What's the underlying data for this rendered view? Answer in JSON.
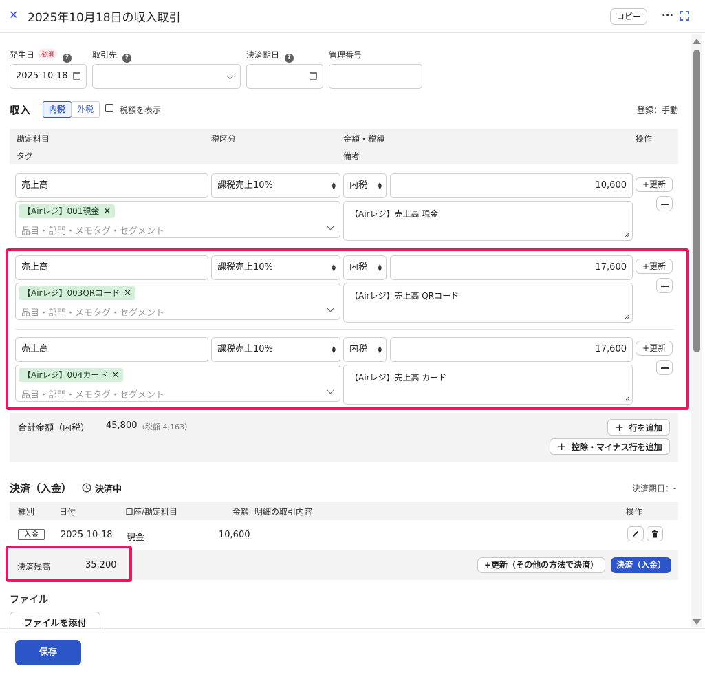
{
  "header": {
    "close_icon": "close-icon",
    "title": "2025年10月18日の収入取引",
    "copy_label": "コピー",
    "more_icon": "more-icon",
    "expand_icon": "expand-icon"
  },
  "form": {
    "date_label": "発生日",
    "required_badge": "必須",
    "date_value": "2025-10-18",
    "partner_label": "取引先",
    "partner_value": "",
    "due_label": "決済期日",
    "due_value": "",
    "mgmt_label": "管理番号",
    "mgmt_value": ""
  },
  "income": {
    "title": "収入",
    "tax_incl": "内税",
    "tax_excl": "外税",
    "show_tax_label": "税額を表示",
    "register_mode": "登録：手動",
    "columns": {
      "account": "勘定科目",
      "tax_class": "税区分",
      "amount_tax": "金額・税額",
      "ops": "操作",
      "tag": "タグ",
      "memo": "備考"
    },
    "rows": [
      {
        "account": "売上高",
        "tax_class": "課税売上10%",
        "tax_mode": "内税",
        "amount": "10,600",
        "tag": "【Airレジ】001現金",
        "tag_placeholder": "品目・部門・メモタグ・セグメント",
        "memo": "【Airレジ】売上高 現金",
        "update_label": "+更新"
      },
      {
        "account": "売上高",
        "tax_class": "課税売上10%",
        "tax_mode": "内税",
        "amount": "17,600",
        "tag": "【Airレジ】003QRコード",
        "tag_placeholder": "品目・部門・メモタグ・セグメント",
        "memo": "【Airレジ】売上高 QRコード",
        "update_label": "+更新"
      },
      {
        "account": "売上高",
        "tax_class": "課税売上10%",
        "tax_mode": "内税",
        "amount": "17,600",
        "tag": "【Airレジ】004カード",
        "tag_placeholder": "品目・部門・メモタグ・セグメント",
        "memo": "【Airレジ】売上高 カード",
        "update_label": "+更新"
      }
    ],
    "total_label": "合計金額（内税）",
    "total_value": "45,800",
    "total_tax": "（税額 4,163）",
    "add_row_label": "行を追加",
    "add_minus_row_label": "控除・マイナス行を追加"
  },
  "settlement": {
    "title": "決済（入金）",
    "status": "決済中",
    "due": "決済期日：-",
    "columns": {
      "type": "種別",
      "date": "日付",
      "account": "口座/勘定科目",
      "amount": "金額",
      "detail": "明細の取引内容",
      "ops": "操作"
    },
    "rows": [
      {
        "type": "入金",
        "date": "2025-10-18",
        "account": "現金",
        "amount": "10,600",
        "detail": ""
      }
    ],
    "balance_label": "決済残高",
    "balance_value": "35,200",
    "update_other_label": "+更新（その他の方法で決済）",
    "settle_label": "決済（入金）"
  },
  "files": {
    "title": "ファイル",
    "attach_label": "ファイルを添付"
  },
  "footer": {
    "save_label": "保存"
  },
  "colors": {
    "accent": "#2c56c8",
    "highlight": "#f0145c",
    "tag_bg": "#d6efdb"
  }
}
